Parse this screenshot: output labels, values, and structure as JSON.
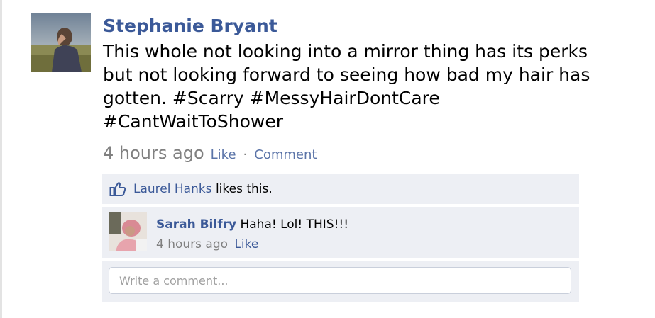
{
  "post": {
    "author": "Stephanie Bryant",
    "text": "This whole not looking into a mirror thing has its perks but not looking forward to seeing how bad my hair has gotten. #Scarry #MessyHairDontCare #CantWaitToShower",
    "time": "4 hours ago",
    "like_label": "Like",
    "separator": "·",
    "comment_label": "Comment"
  },
  "likes": {
    "name": "Laurel Hanks",
    "suffix": "likes this."
  },
  "comment": {
    "author": "Sarah Bilfry",
    "text": "Haha! Lol! THIS!!!",
    "time": "4 hours ago",
    "like_label": "Like"
  },
  "composer": {
    "placeholder": "Write a comment..."
  },
  "colors": {
    "link_blue": "#3b5998",
    "panel_bg": "#edeff4",
    "muted_gray": "#808080"
  },
  "icons": {
    "likes": "thumbs-up-icon"
  }
}
